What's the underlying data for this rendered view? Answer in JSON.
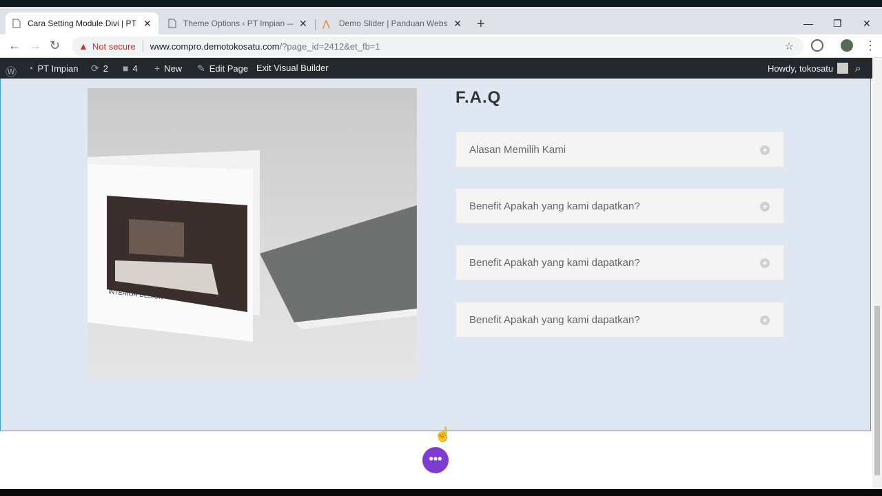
{
  "tabs": [
    {
      "title": "Cara Setting Module Divi | PT Im",
      "active": true
    },
    {
      "title": "Theme Options ‹ PT Impian — W",
      "active": false
    },
    {
      "title": "Demo Slider | Panduan Website",
      "active": false
    }
  ],
  "omnibox": {
    "security": "Not secure",
    "host": "www.compro.demotokosatu.com",
    "path": "/?page_id=2412&et_fb=1"
  },
  "wp_admin": {
    "site": "PT Impian",
    "updates": "2",
    "comments": "4",
    "new": "New",
    "edit": "Edit Page",
    "exit": "Exit Visual Builder",
    "howdy": "Howdy, tokosatu"
  },
  "faq": {
    "title": "F.A.Q",
    "items": [
      "Alasan Memilih Kami",
      "Benefit Apakah yang kami dapatkan?",
      "Benefit Apakah yang kami dapatkan?",
      "Benefit Apakah yang kami dapatkan?"
    ]
  },
  "image": {
    "caption": "INTERIOR DESIGN"
  },
  "fab": {
    "label": "•••"
  },
  "colors": {
    "accent": "#7e3bd0",
    "section_bg": "#dfe8f2",
    "outline": "#3e9bd6"
  }
}
